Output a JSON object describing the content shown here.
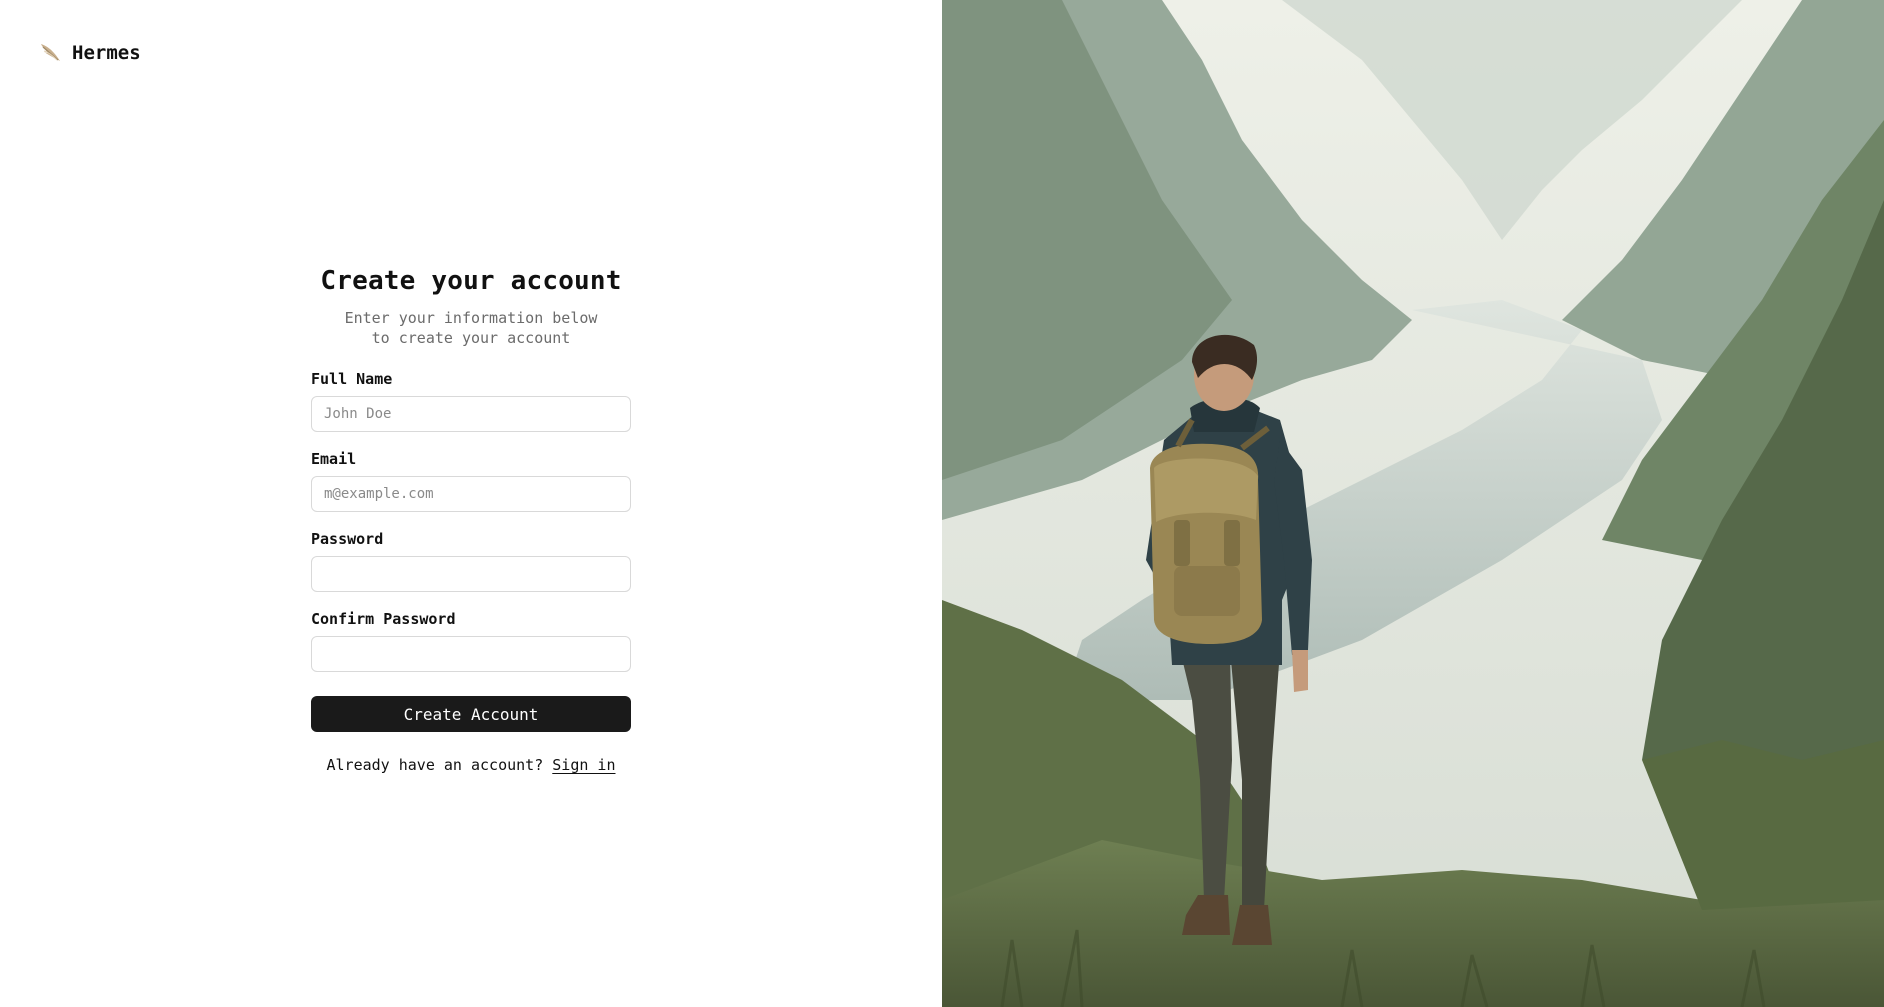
{
  "brand": {
    "name": "Hermes",
    "icon": "winged-feather-icon",
    "icon_color": "#c9b08e"
  },
  "form": {
    "title": "Create your account",
    "subtitle": "Enter your information below to create your account",
    "fields": [
      {
        "label": "Full Name",
        "placeholder": "John Doe",
        "value": ""
      },
      {
        "label": "Email",
        "placeholder": "m@example.com",
        "value": ""
      },
      {
        "label": "Password",
        "placeholder": "",
        "value": ""
      },
      {
        "label": "Confirm Password",
        "placeholder": "",
        "value": ""
      }
    ],
    "submit_label": "Create Account",
    "signin_prompt": "Already have an account?",
    "signin_link": "Sign in"
  },
  "hero": {
    "image": "hiker-overlooking-misty-valley",
    "colors": {
      "sky": "#e8ebe3",
      "mist": "#c9d3c9",
      "mountain": "#8fa293",
      "foliage": "#5d6e4a",
      "river": "#b9c6c2",
      "jacket": "#2f4147",
      "backpack": "#9a8754",
      "pants": "#4b4d42"
    }
  },
  "colors": {
    "button_bg": "#1a1a1a",
    "button_text": "#ffffff",
    "input_border": "#d9d9d9",
    "subtitle": "#6b6b6b"
  }
}
